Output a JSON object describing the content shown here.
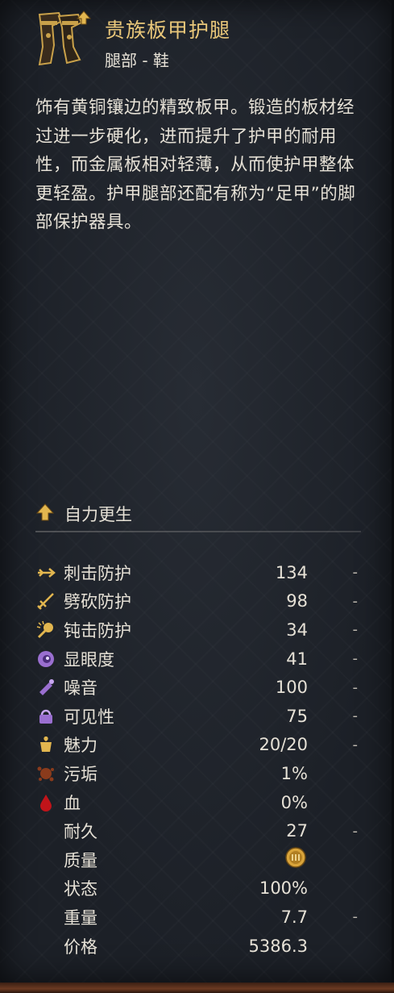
{
  "item": {
    "name": "贵族板甲护腿",
    "category": "腿部 - 鞋",
    "description": "饰有黄铜镶边的精致板甲。锻造的板材经过进一步硬化，进而提升了护甲的耐用性，而金属板相对轻薄，从而使护甲整体更轻盈。护甲腿部还配有称为“足甲”的脚部保护器具。"
  },
  "trait": {
    "label": "自力更生",
    "icon": "up-arrow-icon"
  },
  "stats": [
    {
      "key": "pierce",
      "label": "刺击防护",
      "value": "134",
      "dash": "-",
      "icon": "pierce-protection-icon"
    },
    {
      "key": "slash",
      "label": "劈砍防护",
      "value": "98",
      "dash": "-",
      "icon": "slash-protection-icon"
    },
    {
      "key": "blunt",
      "label": "钝击防护",
      "value": "34",
      "dash": "-",
      "icon": "blunt-protection-icon"
    },
    {
      "key": "conspicuousness",
      "label": "显眼度",
      "value": "41",
      "dash": "-",
      "icon": "eye-icon"
    },
    {
      "key": "noise",
      "label": "噪音",
      "value": "100",
      "dash": "-",
      "icon": "bell-icon"
    },
    {
      "key": "visibility",
      "label": "可见性",
      "value": "75",
      "dash": "-",
      "icon": "visibility-icon"
    },
    {
      "key": "charisma",
      "label": "魅力",
      "value": "20/20",
      "dash": "-",
      "icon": "charisma-icon"
    },
    {
      "key": "dirt",
      "label": "污垢",
      "value": "1%",
      "dash": "",
      "icon": "dirt-icon"
    },
    {
      "key": "blood",
      "label": "血",
      "value": "0%",
      "dash": "",
      "icon": "blood-drop-icon"
    },
    {
      "key": "durability",
      "label": "耐久",
      "value": "27",
      "dash": "-",
      "icon": ""
    },
    {
      "key": "quality",
      "label": "质量",
      "value": "",
      "dash": "",
      "icon": "quality-tier-iii-icon"
    },
    {
      "key": "condition",
      "label": "状态",
      "value": "100%",
      "dash": "",
      "icon": ""
    },
    {
      "key": "weight",
      "label": "重量",
      "value": "7.7",
      "dash": "-",
      "icon": ""
    },
    {
      "key": "price",
      "label": "价格",
      "value": "5386.3",
      "dash": "",
      "icon": ""
    }
  ],
  "colors": {
    "title": "#e9c77a",
    "text": "#e6e1d6",
    "panel": "#1c2027",
    "accent_gold": "#d9a43a",
    "blood_red": "#c0141a",
    "dirt_brown": "#8a3b1c",
    "purple": "#9a6fd0"
  }
}
